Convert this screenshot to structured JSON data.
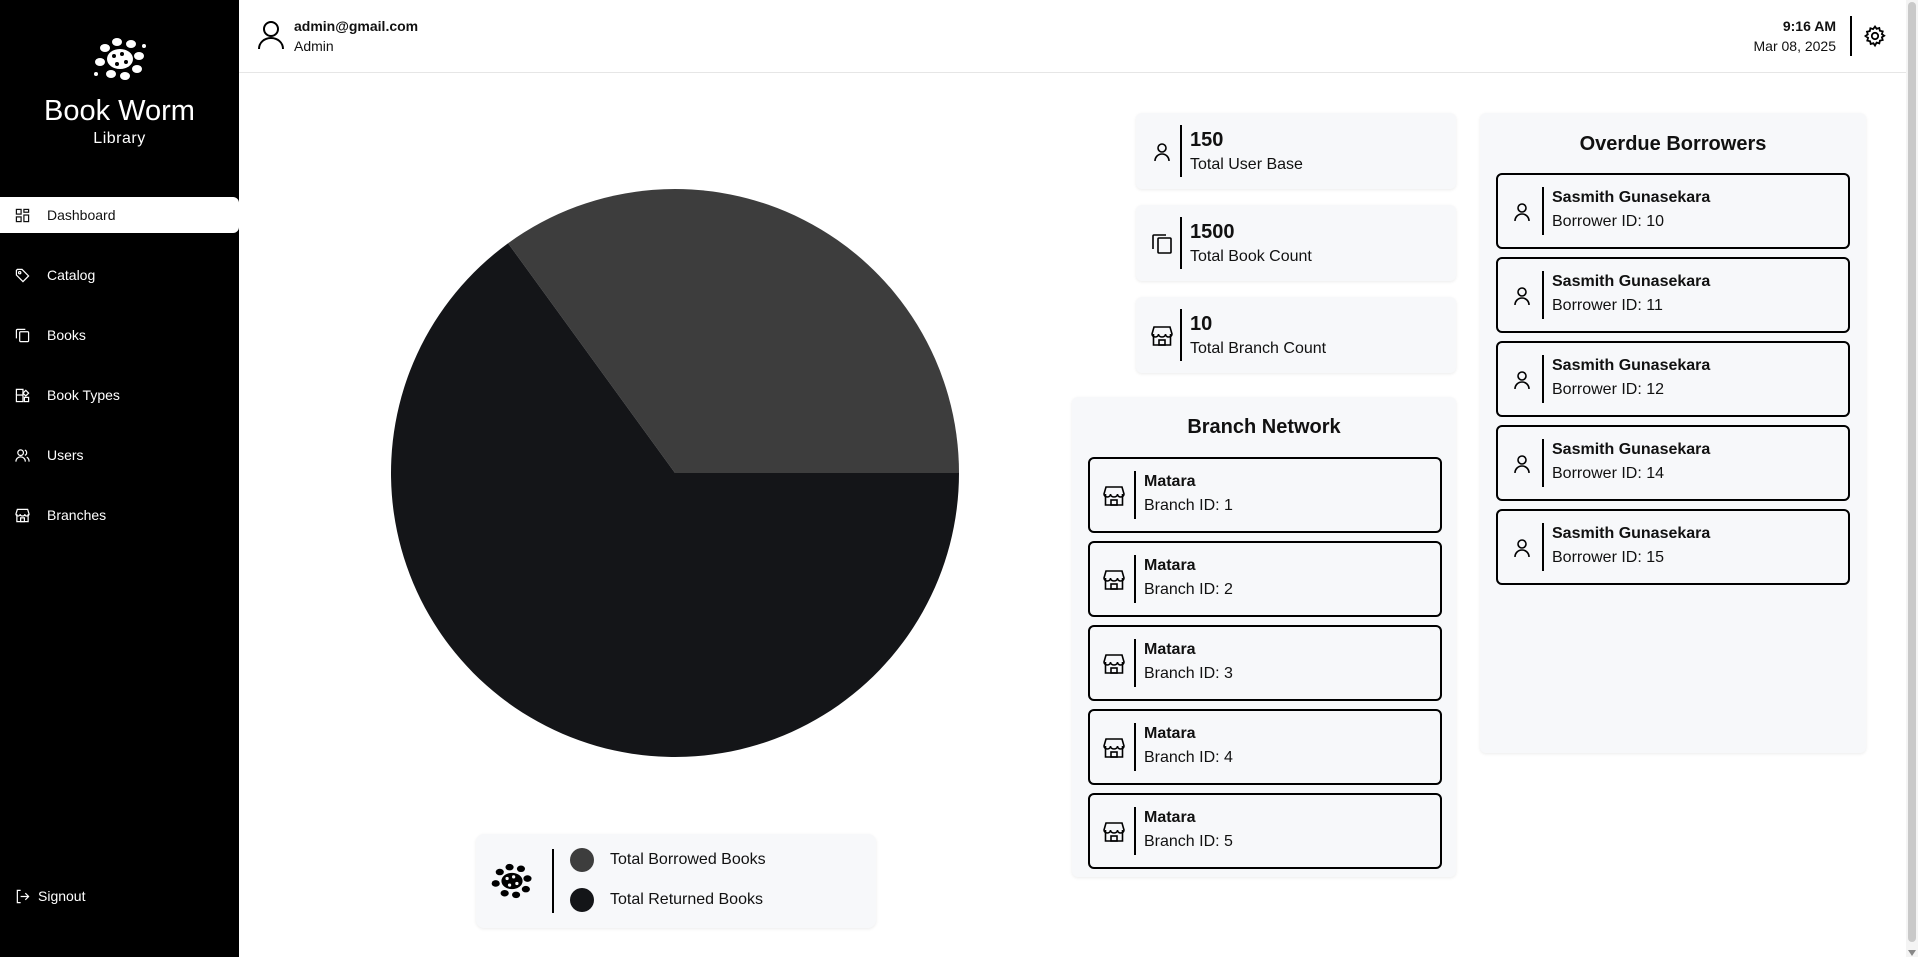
{
  "brand": {
    "title": "Book Worm",
    "subtitle": "Library"
  },
  "nav": {
    "items": [
      {
        "label": "Dashboard",
        "icon": "dashboard-icon",
        "active": true
      },
      {
        "label": "Catalog",
        "icon": "tag-icon"
      },
      {
        "label": "Books",
        "icon": "books-icon"
      },
      {
        "label": "Book Types",
        "icon": "book-types-icon"
      },
      {
        "label": "Users",
        "icon": "users-icon"
      },
      {
        "label": "Branches",
        "icon": "store-icon"
      }
    ],
    "signout": "Signout"
  },
  "header": {
    "email": "admin@gmail.com",
    "role": "Admin",
    "time": "9:16 AM",
    "date": "Mar 08, 2025"
  },
  "chart_data": {
    "type": "pie",
    "slices": [
      {
        "label": "Total Borrowed Books",
        "value": 35,
        "color": "#3d3d3d"
      },
      {
        "label": "Total Returned Books",
        "value": 65,
        "color": "#141518"
      }
    ]
  },
  "stats": [
    {
      "value": "150",
      "label": "Total User Base",
      "icon": "user-icon"
    },
    {
      "value": "1500",
      "label": "Total Book Count",
      "icon": "books-icon"
    },
    {
      "value": "10",
      "label": "Total Branch Count",
      "icon": "store-icon"
    }
  ],
  "branch_network": {
    "title": "Branch Network",
    "items": [
      {
        "name": "Matara",
        "id": "Branch ID: 1"
      },
      {
        "name": "Matara",
        "id": "Branch ID: 2"
      },
      {
        "name": "Matara",
        "id": "Branch ID: 3"
      },
      {
        "name": "Matara",
        "id": "Branch ID: 4"
      },
      {
        "name": "Matara",
        "id": "Branch ID: 5"
      }
    ]
  },
  "overdue": {
    "title": "Overdue Borrowers",
    "items": [
      {
        "name": "Sasmith Gunasekara",
        "id": "Borrower ID: 10"
      },
      {
        "name": "Sasmith Gunasekara",
        "id": "Borrower ID: 11"
      },
      {
        "name": "Sasmith Gunasekara",
        "id": "Borrower ID: 12"
      },
      {
        "name": "Sasmith Gunasekara",
        "id": "Borrower ID: 14"
      },
      {
        "name": "Sasmith Gunasekara",
        "id": "Borrower ID: 15"
      }
    ]
  }
}
